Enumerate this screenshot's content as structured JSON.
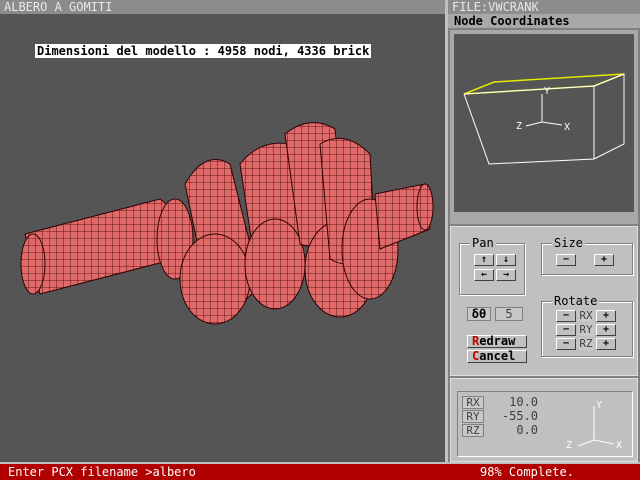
{
  "window": {
    "title": "ALBERO A GOMITI",
    "file_label": "FILE:VWCRANK"
  },
  "viewport": {
    "model_info": "Dimensioni del modello : 4958 nodi, 4336 brick"
  },
  "panel": {
    "header": "Node Coordinates",
    "mini_axes": {
      "y": "Y",
      "x": "X",
      "z": "Z"
    },
    "pan": {
      "label": "Pan",
      "up": "↑",
      "down": "↓",
      "left": "←",
      "right": "→"
    },
    "size": {
      "label": "Size",
      "minus": "−",
      "plus": "+"
    },
    "step": {
      "label": "δθ",
      "value": "5"
    },
    "rotate": {
      "label": "Rotate",
      "rows": [
        {
          "axis": "RX",
          "minus": "−",
          "plus": "+"
        },
        {
          "axis": "RY",
          "minus": "−",
          "plus": "+"
        },
        {
          "axis": "RZ",
          "minus": "−",
          "plus": "+"
        }
      ]
    },
    "redraw": {
      "hotkey": "R",
      "rest": "edraw"
    },
    "cancel": {
      "hotkey": "C",
      "rest": "ancel"
    },
    "readout": {
      "rows": [
        {
          "label": "RX",
          "value": "10.0"
        },
        {
          "label": "RY",
          "value": "-55.0"
        },
        {
          "label": "RZ",
          "value": "0.0"
        }
      ],
      "axes": {
        "y": "Y",
        "x": "X",
        "z": "Z"
      }
    }
  },
  "status": {
    "prompt": "Enter PCX filename >albero",
    "progress": "98% Complete."
  },
  "colors": {
    "mesh_fill": "#e06464",
    "mesh_line": "#400000",
    "status_bg": "#b00000",
    "mini_box": "#e8e800"
  }
}
